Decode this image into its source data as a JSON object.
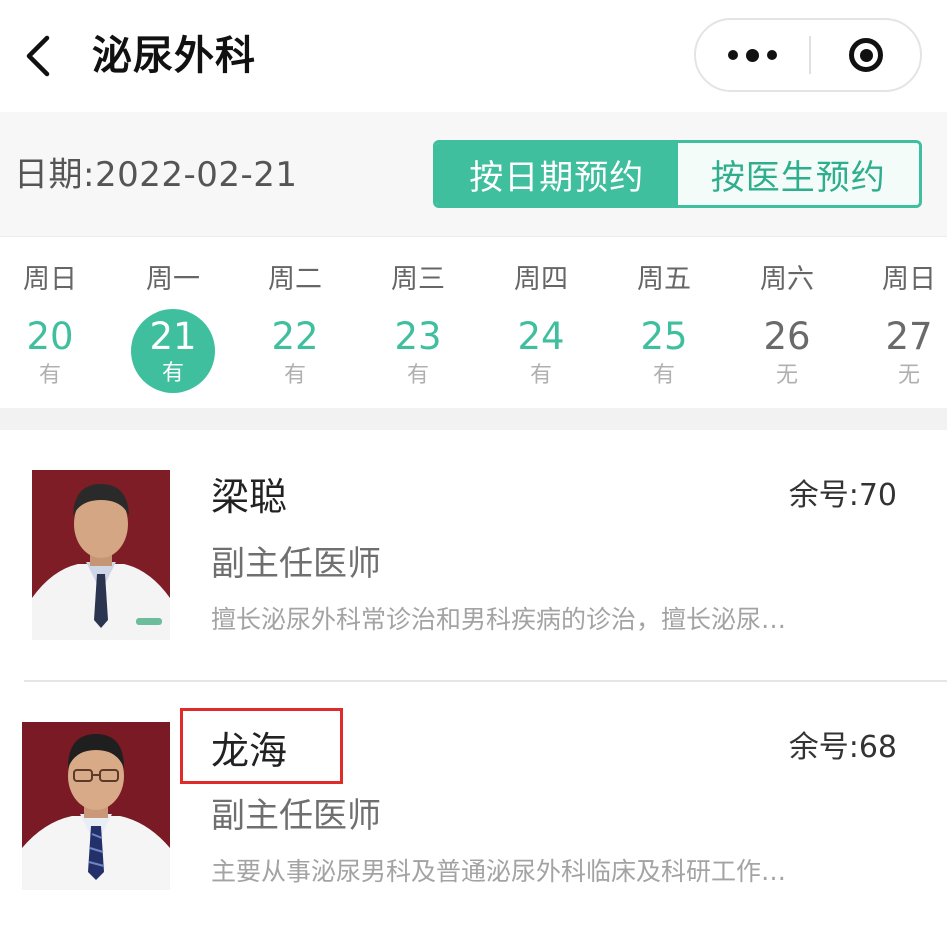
{
  "nav": {
    "title": "泌尿外科",
    "back_icon": "chevron-left-icon",
    "more_icon": "more-dots-icon",
    "close_icon": "target-circle-icon"
  },
  "date_bar": {
    "date_text": "日期:2022-02-21",
    "by_date_label": "按日期预约",
    "by_doctor_label": "按医生预约",
    "accent_color": "#3fbf9e"
  },
  "week": [
    {
      "weekday": "周日",
      "day": "20",
      "avail": "有"
    },
    {
      "weekday": "周一",
      "day": "21",
      "avail": "有"
    },
    {
      "weekday": "周二",
      "day": "22",
      "avail": "有"
    },
    {
      "weekday": "周三",
      "day": "23",
      "avail": "有"
    },
    {
      "weekday": "周四",
      "day": "24",
      "avail": "有"
    },
    {
      "weekday": "周五",
      "day": "25",
      "avail": "有"
    },
    {
      "weekday": "周六",
      "day": "26",
      "avail": "无"
    },
    {
      "weekday": "周日",
      "day": "27",
      "avail": "无"
    }
  ],
  "selected_day": "21",
  "doctors": [
    {
      "name": "梁聪",
      "title": "副主任医师",
      "remaining": "余号:70",
      "description": "擅长泌尿外科常诊治和男科疾病的诊治，擅长泌尿…"
    },
    {
      "name": "龙海",
      "title": "副主任医师",
      "remaining": "余号:68",
      "description": "主要从事泌尿男科及普通泌尿外科临床及科研工作…"
    }
  ]
}
